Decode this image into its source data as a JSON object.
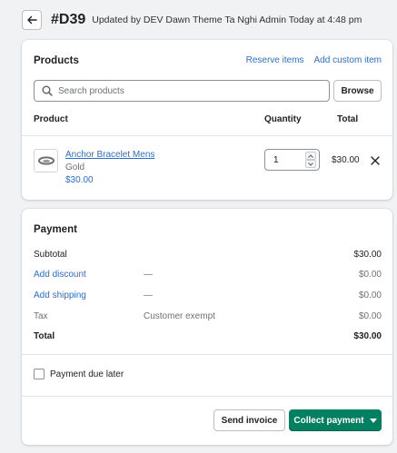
{
  "header": {
    "order_id": "#D39",
    "subtitle": "Updated by DEV Dawn Theme Ta Nghi Admin Today at 4:48 pm",
    "back_icon": "arrow-left-icon"
  },
  "products": {
    "heading": "Products",
    "reserve_link": "Reserve items",
    "add_custom_link": "Add custom item",
    "search_placeholder": "Search products",
    "search_value": "",
    "browse_label": "Browse",
    "columns": {
      "product": "Product",
      "quantity": "Quantity",
      "total": "Total"
    },
    "items": [
      {
        "name": "Anchor Bracelet Mens",
        "variant": "Gold",
        "price": "$30.00",
        "quantity": "1",
        "total": "$30.00"
      }
    ]
  },
  "payment": {
    "heading": "Payment",
    "subtotal": {
      "label": "Subtotal",
      "value": "$30.00"
    },
    "discount": {
      "label": "Add discount",
      "note": "—",
      "value": "$0.00"
    },
    "shipping": {
      "label": "Add shipping",
      "note": "—",
      "value": "$0.00"
    },
    "tax": {
      "label": "Tax",
      "note": "Customer exempt",
      "value": "$0.00"
    },
    "total": {
      "label": "Total",
      "value": "$30.00"
    },
    "due_later": {
      "label": "Payment due later",
      "checked": false
    },
    "send_invoice_label": "Send invoice",
    "collect_payment_label": "Collect payment"
  },
  "colors": {
    "accent": "#008060",
    "link": "#2c6ecb",
    "background": "#f1f2f4"
  }
}
